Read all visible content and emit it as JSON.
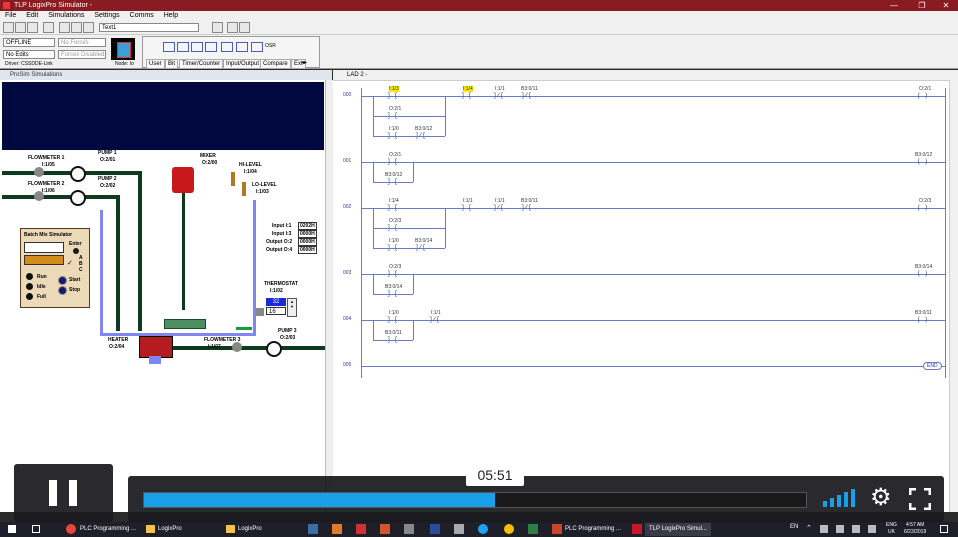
{
  "window": {
    "title": "TLP LogixPro Simulator -",
    "controls": [
      "—",
      "❐",
      "✕"
    ]
  },
  "menu": [
    "File",
    "Edit",
    "Simulations",
    "Settings",
    "Comms",
    "Help"
  ],
  "toolbar": {
    "filename": "Text1"
  },
  "status": {
    "mode": "OFFLINE",
    "forces": "No Forces",
    "edits": "No Edits",
    "forces_enabled": "Forces Disabled",
    "driver": "Driver: CSSDDE-Link",
    "node": "Node: Io"
  },
  "instr_tabs": [
    "User",
    "Bit",
    "Timer/Counter",
    "Input/Output",
    "Compare",
    "Ext"
  ],
  "instr_osr": "OSR",
  "left_panel": {
    "caption": "ProSim Simulations",
    "flowmeter1": {
      "name": "FLOWMETER 1",
      "addr": "I:1/05"
    },
    "flowmeter2": {
      "name": "FLOWMETER 2",
      "addr": "I:1/06"
    },
    "pump1": {
      "name": "PUMP 1",
      "addr": "O:2/01"
    },
    "pump2": {
      "name": "PUMP 2",
      "addr": "O:2/02"
    },
    "mixer": {
      "name": "MIXER",
      "addr": "O:2/00"
    },
    "hilevel": {
      "name": "HI-LEVEL",
      "addr": "I:1/04"
    },
    "lolevel": {
      "name": "LO-LEVEL",
      "addr": "I:1/03"
    },
    "inputs": [
      {
        "label": "Input I:1",
        "value": "0202H"
      },
      {
        "label": "Input I:3",
        "value": "0000H"
      },
      {
        "label": "Output O:2",
        "value": "0000H"
      },
      {
        "label": "Output O:4",
        "value": "0000H"
      }
    ],
    "thermostat": {
      "name": "THERMOSTAT",
      "addr": "I:1/02",
      "setpoint": "32",
      "actual": "16"
    },
    "heater": {
      "name": "HEATER",
      "addr": "O:2/04"
    },
    "flowmeter3": {
      "name": "FLOWMETER 3",
      "addr": "I:1/07"
    },
    "pump3": {
      "name": "PUMP 3",
      "addr": "O:2/03"
    },
    "batch": {
      "title": "Batch Mix Simulator",
      "enter": "Enter",
      "abc": [
        "A",
        "B",
        "C"
      ],
      "buttons": [
        "Run",
        "Idle",
        "Full"
      ],
      "start": "Start",
      "stop": "Stop"
    }
  },
  "ladder": {
    "caption": "LAD 2 -",
    "rungs": [
      {
        "num": "000",
        "tags": [
          "I:1/3",
          "I:1/4",
          "I:1/1",
          "B3:0/11",
          "O:2/1",
          "O:2/1",
          "I:1/0",
          "B3:0/12"
        ]
      },
      {
        "num": "001",
        "tags": [
          "O:2/1",
          "B3:0/12",
          "B3:0/12"
        ]
      },
      {
        "num": "002",
        "tags": [
          "I:1/4",
          "I:1/1",
          "I:1/1",
          "B3:0/11",
          "O:2/3",
          "O:2/3",
          "I:1/0",
          "B3:0/14"
        ]
      },
      {
        "num": "003",
        "tags": [
          "O:2/3",
          "B3:0/14",
          "B3:0/14"
        ]
      },
      {
        "num": "004",
        "tags": [
          "I:1/0",
          "I:1/1",
          "B3:0/11",
          "B3:0/11"
        ]
      },
      {
        "num": "005",
        "tags": [
          "END"
        ]
      }
    ]
  },
  "player": {
    "time": "05:51",
    "progress": 0.53
  },
  "taskbar": {
    "items": [
      "PLC Programming ...",
      "LogixPro",
      "LogixPro",
      "PLC Programming ...",
      "TLP LogixPro Simul..."
    ],
    "lang": "ENG",
    "region": "UK",
    "clock": "4:57 AM",
    "date": "6/23/2019",
    "tray_lang": "EN"
  }
}
